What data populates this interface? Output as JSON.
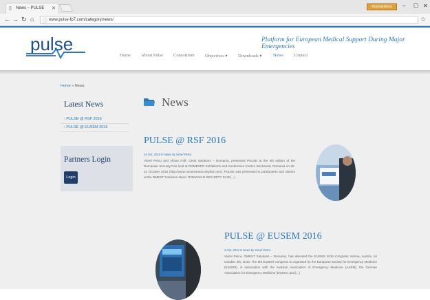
{
  "browser": {
    "tab_title": "News – PULSE",
    "url": "www.pulse-fp7.com/category/news/",
    "user_badge": "Konstantinos",
    "controls": {
      "minimize": "–",
      "maximize": "☐",
      "close": "✕"
    }
  },
  "site": {
    "logo_text": "pulse",
    "tagline": "Platform for European Medical Support During Major Emergencies",
    "nav": [
      {
        "label": "Home"
      },
      {
        "label": "About Pulse"
      },
      {
        "label": "Consortium"
      },
      {
        "label": "Objectives ▾"
      },
      {
        "label": "Downloads ▾"
      },
      {
        "label": "News",
        "active": true
      },
      {
        "label": "Contact"
      }
    ],
    "accent_color": "#2a78b8"
  },
  "breadcrumb": {
    "home": "Home",
    "separator": " » ",
    "current": "News"
  },
  "sidebar": {
    "latest_title": "Latest News",
    "links": [
      "PULSE @ RSF 2016",
      "PULSE @ EUSEM 2016"
    ],
    "partners_title": "Partners Login",
    "login_label": "Login"
  },
  "main": {
    "heading": "News",
    "posts": [
      {
        "title": "PULSE @ RSF 2016",
        "meta": "24 Oct, 2016 in News by Viorel Petcu",
        "excerpt": "Viorel Petcu and Vlinas Paff, Orest Solutions – Romania, presented PULSE at the 4th edition of the Romanian Security Fair held at ROMEXPO Exhibitions and Conference Center, Bucharest, Romania on 20-22 October 2016 (http://www.romaniansecurityfair.com). PULSE was presented to participants and visitors at the OMEST Solutions stand. ROMANIAN SECURITY FAIR",
        "more": "[...]"
      },
      {
        "title": "PULSE @ EUSEM 2016",
        "meta": "5 Oct, 2016 in News by Viorel Petcu",
        "excerpt": "Viorel Petcu, OMEST Solutions – Romania, has attended the EUSEM 2016 Congress Vienna, Austria, on October 4th, 2016. The 8th EuSEM Congress is organised by the European Society for Emergency Medicine (EuSEM), in association with the Austrian Association of Emergency Medicine (AAEM), the German Association for Emergency Medicine (DGINA) and",
        "more": "[...]"
      }
    ]
  }
}
